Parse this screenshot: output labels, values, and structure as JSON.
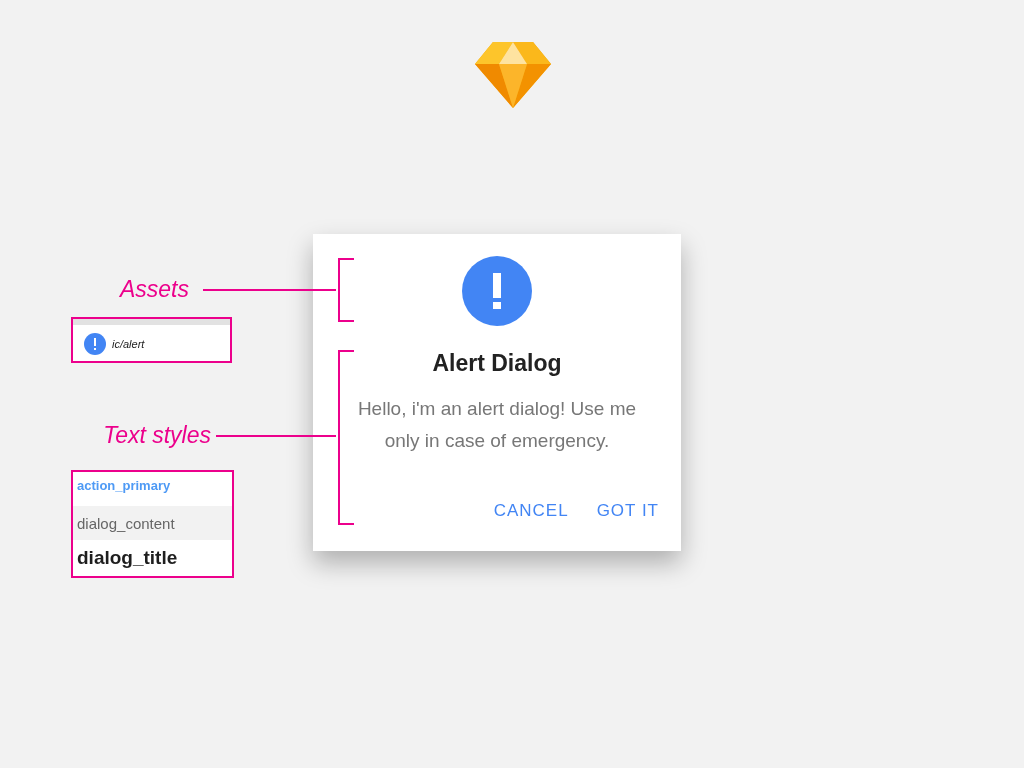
{
  "annotations": [
    {
      "label": "Assets"
    },
    {
      "label": "Text styles"
    }
  ],
  "asset_list": [
    {
      "name": "ic/alert"
    }
  ],
  "text_styles": [
    {
      "name": "action_primary",
      "kind": "action"
    },
    {
      "name": "dialog_content",
      "kind": "content"
    },
    {
      "name": "dialog_title",
      "kind": "title"
    }
  ],
  "dialog": {
    "title": "Alert Dialog",
    "message": "Hello, i'm an alert dialog! Use me only in case of emergency.",
    "buttons": [
      "CANCEL",
      "GOT IT"
    ]
  }
}
